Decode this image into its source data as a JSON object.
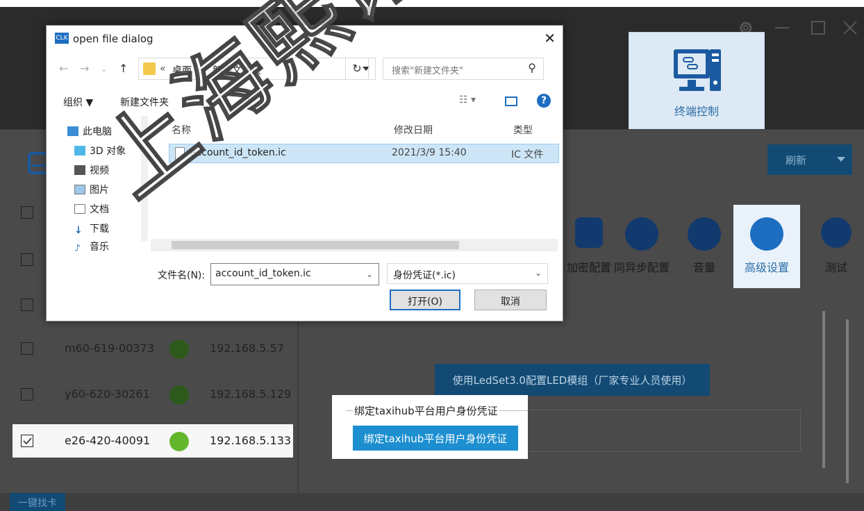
{
  "app": {
    "terminal_control_label": "终端控制",
    "refresh_label": "刷新",
    "find_card_label": "一键找卡",
    "watermark_text": "上海熙讯电"
  },
  "func_icons": [
    {
      "label": "加密配置",
      "icon": "lock-icon"
    },
    {
      "label": "同异步配置",
      "icon": "sync-icon"
    },
    {
      "label": "音量",
      "icon": "volume-icon"
    },
    {
      "label": "高级设置",
      "icon": "gear-icon"
    },
    {
      "label": "测试",
      "icon": "test-icon"
    }
  ],
  "devices": [
    {
      "name": "m60-619-00373",
      "ip": "192.168.5.57",
      "checked": false
    },
    {
      "name": "y60-620-30261",
      "ip": "192.168.5.129",
      "checked": false
    },
    {
      "name": "e26-420-40091",
      "ip": "192.168.5.133",
      "checked": true
    }
  ],
  "advanced": {
    "ledset_button": "使用LedSet3.0配置LED模组（厂家专业人员使用）",
    "bind_group_title": "绑定taxihub平台用户身份凭证",
    "bind_button": "绑定taxihub平台用户身份凭证"
  },
  "dialog": {
    "title": "open file dialog",
    "app_icon_text": "CLK",
    "address": {
      "prefix": "«",
      "crumb1": "桌面",
      "crumb2": "新建文件夹"
    },
    "search_placeholder": "搜索\"新建文件夹\"",
    "organize_label": "组织 ▼",
    "new_folder_label": "新建文件夹",
    "sidebar": [
      {
        "label": "此电脑",
        "icon": "computer-icon"
      },
      {
        "label": "3D 对象",
        "icon": "cube-icon"
      },
      {
        "label": "视频",
        "icon": "video-icon"
      },
      {
        "label": "图片",
        "icon": "picture-icon"
      },
      {
        "label": "文档",
        "icon": "document-icon"
      },
      {
        "label": "下载",
        "icon": "download-icon"
      },
      {
        "label": "音乐",
        "icon": "music-icon"
      }
    ],
    "columns": {
      "name": "名称",
      "date": "修改日期",
      "type": "类型"
    },
    "files": [
      {
        "name": "account_id_token.ic",
        "date": "2021/3/9 15:40",
        "type": "IC 文件"
      }
    ],
    "filename_label": "文件名(N):",
    "filename_value": "account_id_token.ic",
    "filetype_value": "身份凭证(*.ic)",
    "open_button": "打开(O)",
    "cancel_button": "取消"
  },
  "colors": {
    "accent": "#1d8fd1",
    "dark_blue": "#124a73",
    "online_green": "#64b62d",
    "offline_green": "#2d5a1c"
  }
}
